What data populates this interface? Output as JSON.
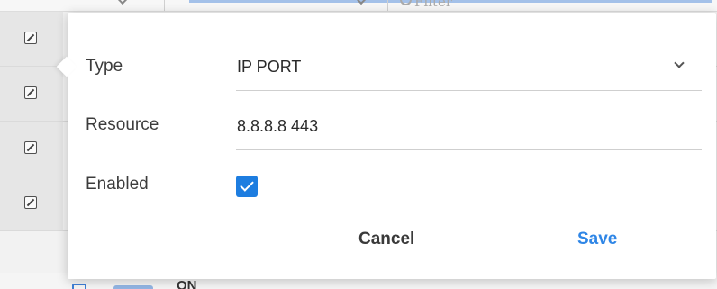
{
  "background": {
    "filter_placeholder": "Filter",
    "bottom_row_text": "ON"
  },
  "form": {
    "type": {
      "label": "Type",
      "value": "IP PORT"
    },
    "resource": {
      "label": "Resource",
      "value": "8.8.8.8 443"
    },
    "enabled": {
      "label": "Enabled",
      "checked": true
    }
  },
  "actions": {
    "cancel_label": "Cancel",
    "save_label": "Save"
  },
  "colors": {
    "accent": "#1d7de0",
    "save_text": "#2f86e6"
  },
  "icons": {
    "row_action": "edit-icon",
    "select_toggle": "chevron-down-icon",
    "checkbox": "check-mark-icon"
  }
}
